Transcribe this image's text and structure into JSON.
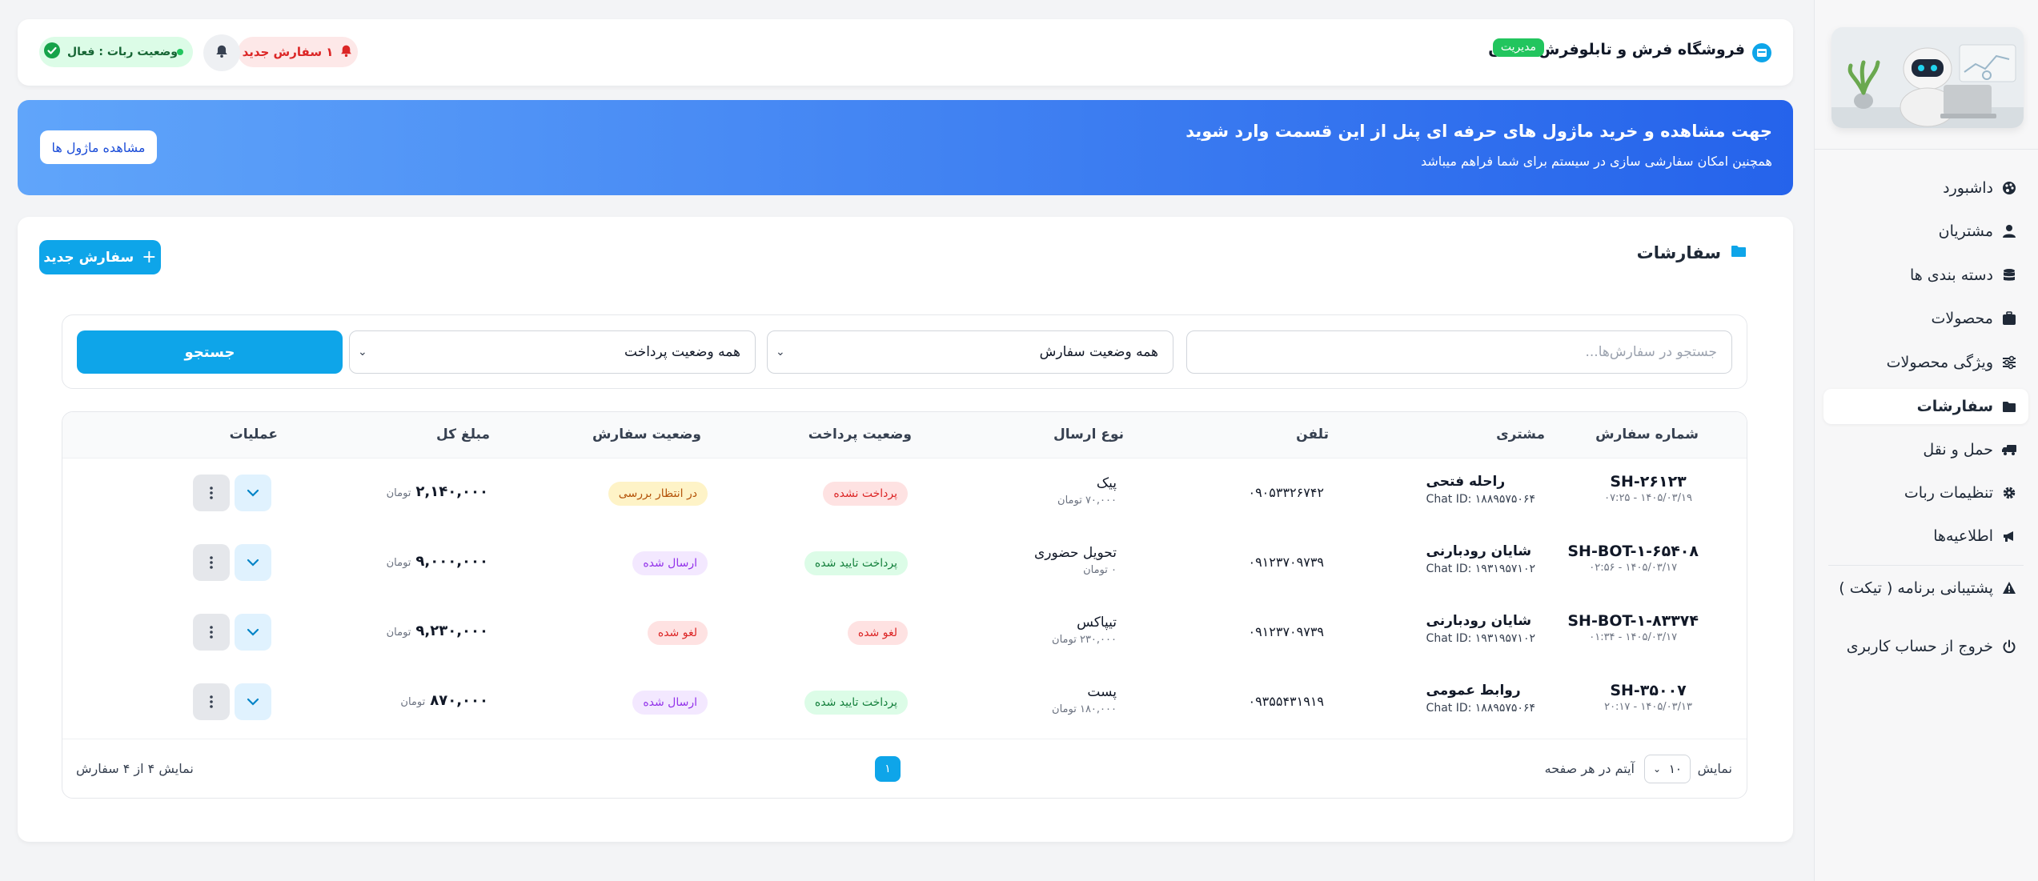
{
  "sidebar": {
    "items": [
      {
        "label": "داشبورد",
        "icon": "palette-icon"
      },
      {
        "label": "مشتریان",
        "icon": "user-icon"
      },
      {
        "label": "دسته بندی ها",
        "icon": "database-icon"
      },
      {
        "label": "محصولات",
        "icon": "suitcase-icon"
      },
      {
        "label": "ویژگی محصولات",
        "icon": "sliders-icon"
      },
      {
        "label": "سفارشات",
        "icon": "folder-icon"
      },
      {
        "label": "حمل و نقل",
        "icon": "truck-icon"
      },
      {
        "label": "تنظیمات ربات",
        "icon": "gear-icon"
      },
      {
        "label": "اطلاعیه‌ها",
        "icon": "megaphone-icon"
      }
    ],
    "support": "پشتیبانی برنامه ( تیکت )",
    "logout": "خروج از حساب کاربری"
  },
  "header": {
    "store_name": "فروشگاه فرش و تابلوفرش شایان",
    "role_badge": "مدیریت",
    "new_orders": "۱ سفارش جدید",
    "bot_status": "وضعیت ربات : فعال"
  },
  "banner": {
    "title": "جهت مشاهده و خرید ماژول های حرفه ای پنل از این قسمت وارد شوید",
    "subtitle": "همچنین امکان سفارشی سازی در سیستم برای شما فراهم میباشد",
    "button": "مشاهده ماژول ها"
  },
  "orders": {
    "title": "سفارشات",
    "new_button": "سفارش جدید",
    "search_placeholder": "جستجو در سفارش‌ها...",
    "order_status_filter": "همه وضعیت سفارش",
    "payment_status_filter": "همه وضعیت پرداخت",
    "search_button": "جستجو",
    "columns": [
      "شماره سفارش",
      "مشتری",
      "تلفن",
      "نوع ارسال",
      "وضعیت پرداخت",
      "وضعیت سفارش",
      "مبلغ کل",
      "عملیات"
    ],
    "rows": [
      {
        "order_no": "SH-۲۶۱۲۳",
        "date": "۱۴۰۵/۰۳/۱۹ - ۰۷:۲۵",
        "customer": "راحله فتحی",
        "chat_id": "Chat ID: ۱۸۸۹۵۷۵۰۶۴",
        "phone": "۰۹۰۵۳۳۲۶۷۴۲",
        "ship": "پیک",
        "ship_cost": "۷۰,۰۰۰ تومان",
        "payment": "پرداخت نشده",
        "status": "در انتظار بررسی",
        "amount": "۲,۱۴۰,۰۰۰",
        "unit": "تومان"
      },
      {
        "order_no": "SH-BOT-۱-۶۵۴۰۸",
        "date": "۱۴۰۵/۰۳/۱۷ - ۰۲:۵۶",
        "customer": "شایان رودبارنی",
        "chat_id": "Chat ID: ۱۹۳۱۹۵۷۱۰۲",
        "phone": "۰۹۱۲۳۷۰۹۷۳۹",
        "ship": "تحویل حضوری",
        "ship_cost": "۰ تومان",
        "payment": "پرداخت تایید شده",
        "status": "ارسال شده",
        "amount": "۹,۰۰۰,۰۰۰",
        "unit": "تومان"
      },
      {
        "order_no": "SH-BOT-۱-۸۳۳۷۴",
        "date": "۱۴۰۵/۰۳/۱۷ - ۰۱:۳۴",
        "customer": "شایان رودبارنی",
        "chat_id": "Chat ID: ۱۹۳۱۹۵۷۱۰۲",
        "phone": "۰۹۱۲۳۷۰۹۷۳۹",
        "ship": "تیپاکس",
        "ship_cost": "۲۳۰,۰۰۰ تومان",
        "payment": "لغو شده",
        "status": "لغو شده",
        "amount": "۹,۲۳۰,۰۰۰",
        "unit": "تومان"
      },
      {
        "order_no": "SH-۳۵۰۰۷",
        "date": "۱۴۰۵/۰۳/۱۳ - ۲۰:۱۷",
        "customer": "روابط عمومی",
        "chat_id": "Chat ID: ۱۸۸۹۵۷۵۰۶۴",
        "phone": "۰۹۳۵۵۴۳۱۹۱۹",
        "ship": "پست",
        "ship_cost": "۱۸۰,۰۰۰ تومان",
        "payment": "پرداخت تایید شده",
        "status": "ارسال شده",
        "amount": "۸۷۰,۰۰۰",
        "unit": "تومان"
      }
    ],
    "footer": {
      "show_label": "نمایش",
      "per_page": "۱۰",
      "per_page_suffix": "آیتم در هر صفحه",
      "page": "۱",
      "summary": "نمایش ۴ از ۴ سفارش"
    }
  },
  "colors": {
    "accent": "#0ea5e9",
    "banner_start": "#60a5fa",
    "banner_end": "#2563eb",
    "success": "#22c55e",
    "danger": "#dc2626"
  }
}
